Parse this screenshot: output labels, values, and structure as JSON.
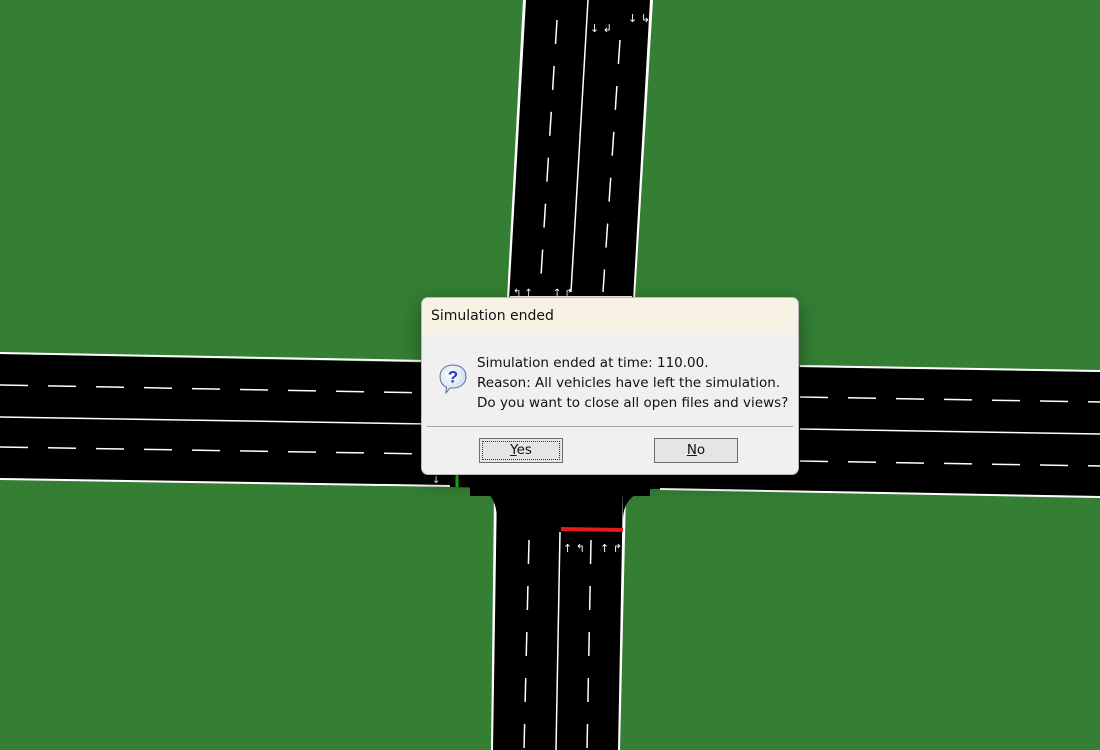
{
  "scene": {
    "grass_color": "#347f34",
    "road_color": "#000000",
    "lane_marking_color": "#ffffff",
    "signal_states": {
      "west_approach": "green",
      "south_approach": "red"
    }
  },
  "dialog": {
    "title": "Simulation ended",
    "icon": "question-icon",
    "messages": [
      "Simulation ended at time: 110.00.",
      "Reason: All vehicles have left the simulation.",
      "Do you want to close all open files and views?"
    ],
    "buttons": {
      "yes": {
        "mnemonic": "Y",
        "rest": "es"
      },
      "no": {
        "mnemonic": "N",
        "rest": "o"
      }
    }
  }
}
